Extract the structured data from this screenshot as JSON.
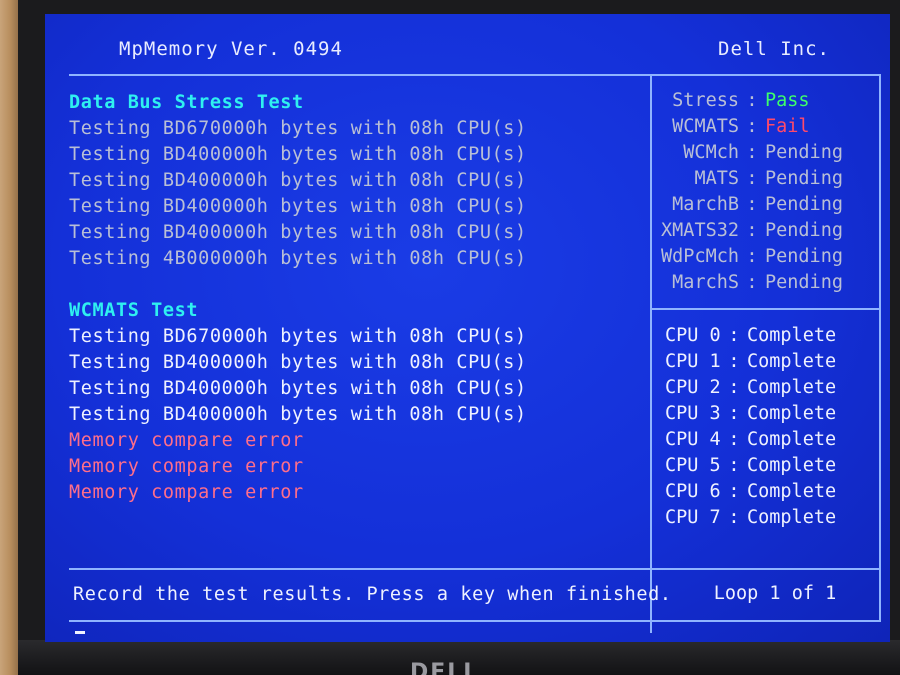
{
  "header": {
    "title": "MpMemory Ver. 0494",
    "vendor": "Dell Inc."
  },
  "log": {
    "section1_heading": "Data Bus Stress Test",
    "section1_lines": [
      "Testing BD670000h bytes with 08h CPU(s)",
      "Testing BD400000h bytes with 08h CPU(s)",
      "Testing BD400000h bytes with 08h CPU(s)",
      "Testing BD400000h bytes with 08h CPU(s)",
      "Testing BD400000h bytes with 08h CPU(s)",
      "Testing 4B000000h bytes with 08h CPU(s)"
    ],
    "section2_heading": "WCMATS Test",
    "section2_lines": [
      "Testing BD670000h bytes with 08h CPU(s)",
      "Testing BD400000h bytes with 08h CPU(s)",
      "Testing BD400000h bytes with 08h CPU(s)",
      "Testing BD400000h bytes with 08h CPU(s)"
    ],
    "errors": [
      "Memory compare error",
      "Memory compare error",
      "Memory compare error"
    ]
  },
  "status": {
    "separator": ":",
    "tests": [
      {
        "name": "Stress",
        "value": "Pass"
      },
      {
        "name": "WCMATS",
        "value": "Fail"
      },
      {
        "name": "WCMch",
        "value": "Pending"
      },
      {
        "name": "MATS",
        "value": "Pending"
      },
      {
        "name": "MarchB",
        "value": "Pending"
      },
      {
        "name": "XMATS32",
        "value": "Pending"
      },
      {
        "name": "WdPcMch",
        "value": "Pending"
      },
      {
        "name": "MarchS",
        "value": "Pending"
      }
    ]
  },
  "cpus": {
    "separator": ":",
    "items": [
      {
        "label": "CPU 0",
        "state": "Complete"
      },
      {
        "label": "CPU 1",
        "state": "Complete"
      },
      {
        "label": "CPU 2",
        "state": "Complete"
      },
      {
        "label": "CPU 3",
        "state": "Complete"
      },
      {
        "label": "CPU 4",
        "state": "Complete"
      },
      {
        "label": "CPU 5",
        "state": "Complete"
      },
      {
        "label": "CPU 6",
        "state": "Complete"
      },
      {
        "label": "CPU 7",
        "state": "Complete"
      }
    ]
  },
  "footer": {
    "message": "Record the test results. Press a key when finished.",
    "loop": "Loop 1 of 1"
  },
  "bezel": {
    "logo": "DELL"
  },
  "colors": {
    "screen_bg": "#1430d8",
    "heading": "#2ff0f0",
    "pass": "#3dff6a",
    "fail": "#ff4a6a",
    "error": "#ff6e8a",
    "border": "#8fb4ff"
  }
}
